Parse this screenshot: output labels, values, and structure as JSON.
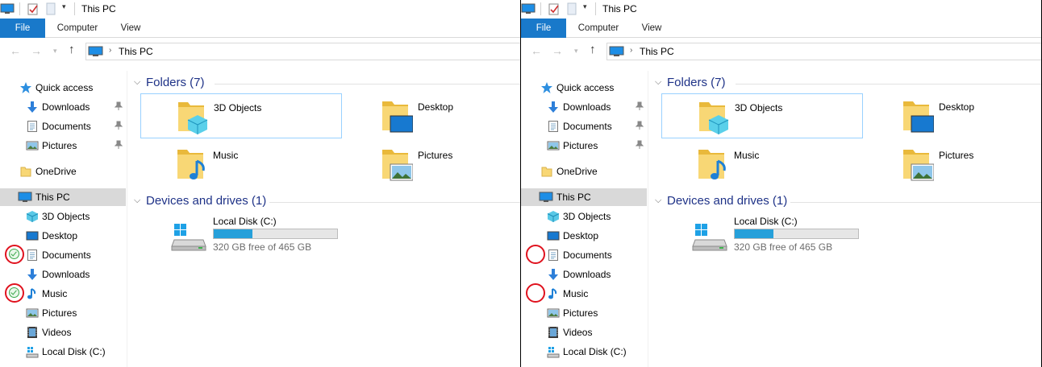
{
  "window": {
    "title": "This PC"
  },
  "ribbon": {
    "tabs": [
      "File",
      "Computer",
      "View"
    ]
  },
  "address": {
    "path": "This PC"
  },
  "nav": {
    "items": [
      {
        "label": "Quick access",
        "icon": "star-icon",
        "pinned": false
      },
      {
        "label": "Downloads",
        "icon": "downloads-icon",
        "pinned": true
      },
      {
        "label": "Documents",
        "icon": "documents-icon",
        "pinned": true
      },
      {
        "label": "Pictures",
        "icon": "pictures-icon",
        "pinned": true
      },
      {
        "label": "OneDrive",
        "icon": "folder-icon",
        "pinned": false
      },
      {
        "label": "This PC",
        "icon": "computer-icon",
        "pinned": false,
        "selected": true
      },
      {
        "label": "3D Objects",
        "icon": "cube-icon",
        "pinned": false
      },
      {
        "label": "Desktop",
        "icon": "desktop-icon",
        "pinned": false
      },
      {
        "label": "Documents",
        "icon": "documents-icon",
        "pinned": false
      },
      {
        "label": "Downloads",
        "icon": "downloads-icon",
        "pinned": false
      },
      {
        "label": "Music",
        "icon": "music-icon",
        "pinned": false
      },
      {
        "label": "Pictures",
        "icon": "pictures-icon",
        "pinned": false
      },
      {
        "label": "Videos",
        "icon": "videos-icon",
        "pinned": false
      },
      {
        "label": "Local Disk (C:)",
        "icon": "drive-icon",
        "pinned": false
      }
    ]
  },
  "groups": {
    "folders": {
      "header": "Folders (7)",
      "items": [
        {
          "label": "3D Objects",
          "icon": "folder-3d-objects-icon"
        },
        {
          "label": "Desktop",
          "icon": "folder-desktop-icon"
        },
        {
          "label": "Music",
          "icon": "folder-music-icon"
        },
        {
          "label": "Pictures",
          "icon": "folder-pictures-icon"
        }
      ]
    },
    "devices": {
      "header": "Devices and drives (1)",
      "drive": {
        "name": "Local Disk (C:)",
        "free_text": "320 GB free of 465 GB",
        "used_fraction": 0.312
      }
    }
  },
  "comparison": {
    "left": {
      "highlighted_items": [
        "Documents",
        "Music"
      ],
      "status": "sync-check-icon"
    },
    "right": {
      "highlighted_items": [
        "Documents",
        "Music"
      ],
      "status": "none"
    }
  },
  "colors": {
    "accent": "#1979ca",
    "highlight": "#e0121e",
    "header": "#1e3287",
    "bar": "#26a0da"
  }
}
